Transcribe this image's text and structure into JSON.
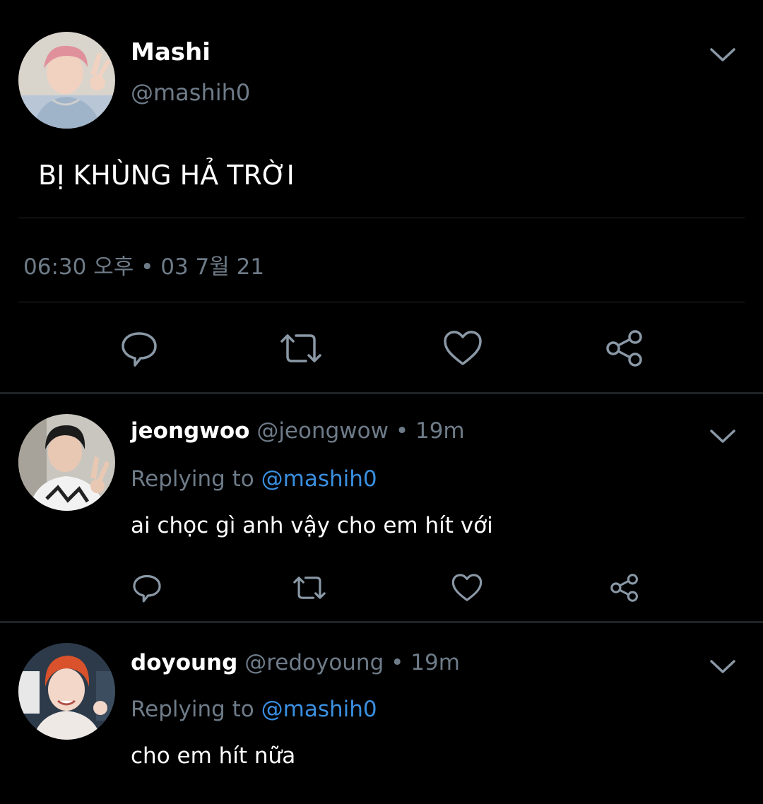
{
  "main_tweet": {
    "display_name": "Mashi",
    "handle": "@mashih0",
    "text": "BỊ KHÙNG HẢ TRỜI",
    "timestamp": "06:30 오후 • 03 7월 21"
  },
  "replies": [
    {
      "display_name": "jeongwoo",
      "handle": "@jeongwow",
      "separator": "•",
      "time": "19m",
      "replying_prefix": "Replying to",
      "replying_handle": "@mashih0",
      "text": "ai chọc gì anh vậy cho em hít với"
    },
    {
      "display_name": "doyoung",
      "handle": "@redoyoung",
      "separator": "•",
      "time": "19m",
      "replying_prefix": "Replying to",
      "replying_handle": "@mashih0",
      "text": "cho em hít nữa"
    }
  ],
  "icons": {
    "reply": "reply-icon",
    "retweet": "retweet-icon",
    "like": "heart-icon",
    "share": "share-icon",
    "more": "chevron-down-icon"
  },
  "colors": {
    "background": "#000000",
    "muted_text": "#6e7b88",
    "link": "#3a8fe0",
    "icon": "#8a98a6",
    "divider": "#24292e"
  }
}
